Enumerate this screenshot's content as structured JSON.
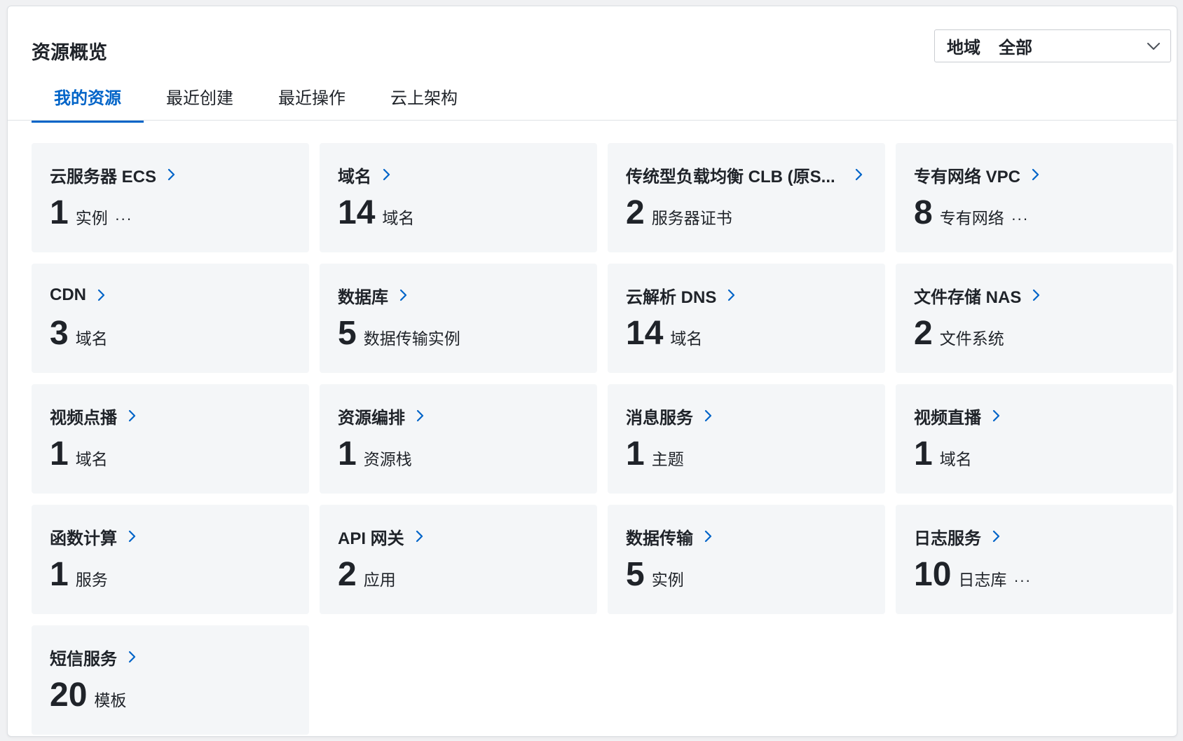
{
  "header": {
    "title": "资源概览",
    "region_label": "地域",
    "region_value": "全部"
  },
  "tabs": [
    {
      "label": "我的资源",
      "active": true
    },
    {
      "label": "最近创建",
      "active": false
    },
    {
      "label": "最近操作",
      "active": false
    },
    {
      "label": "云上架构",
      "active": false
    }
  ],
  "colors": {
    "accent": "#0064c8",
    "card_bg": "#f4f6f8",
    "text": "#1f2329"
  },
  "cards": [
    {
      "name": "云服务器 ECS",
      "count": "1",
      "unit": "实例",
      "more": "···"
    },
    {
      "name": "域名",
      "count": "14",
      "unit": "域名",
      "more": ""
    },
    {
      "name": "传统型负载均衡 CLB (原S...",
      "count": "2",
      "unit": "服务器证书",
      "more": ""
    },
    {
      "name": "专有网络 VPC",
      "count": "8",
      "unit": "专有网络",
      "more": "···"
    },
    {
      "name": "CDN",
      "count": "3",
      "unit": "域名",
      "more": ""
    },
    {
      "name": "数据库",
      "count": "5",
      "unit": "数据传输实例",
      "more": ""
    },
    {
      "name": "云解析 DNS",
      "count": "14",
      "unit": "域名",
      "more": ""
    },
    {
      "name": "文件存储 NAS",
      "count": "2",
      "unit": "文件系统",
      "more": ""
    },
    {
      "name": "视频点播",
      "count": "1",
      "unit": "域名",
      "more": ""
    },
    {
      "name": "资源编排",
      "count": "1",
      "unit": "资源栈",
      "more": ""
    },
    {
      "name": "消息服务",
      "count": "1",
      "unit": "主题",
      "more": ""
    },
    {
      "name": "视频直播",
      "count": "1",
      "unit": "域名",
      "more": ""
    },
    {
      "name": "函数计算",
      "count": "1",
      "unit": "服务",
      "more": ""
    },
    {
      "name": "API 网关",
      "count": "2",
      "unit": "应用",
      "more": ""
    },
    {
      "name": "数据传输",
      "count": "5",
      "unit": "实例",
      "more": ""
    },
    {
      "name": "日志服务",
      "count": "10",
      "unit": "日志库",
      "more": "···"
    },
    {
      "name": "短信服务",
      "count": "20",
      "unit": "模板",
      "more": ""
    }
  ]
}
